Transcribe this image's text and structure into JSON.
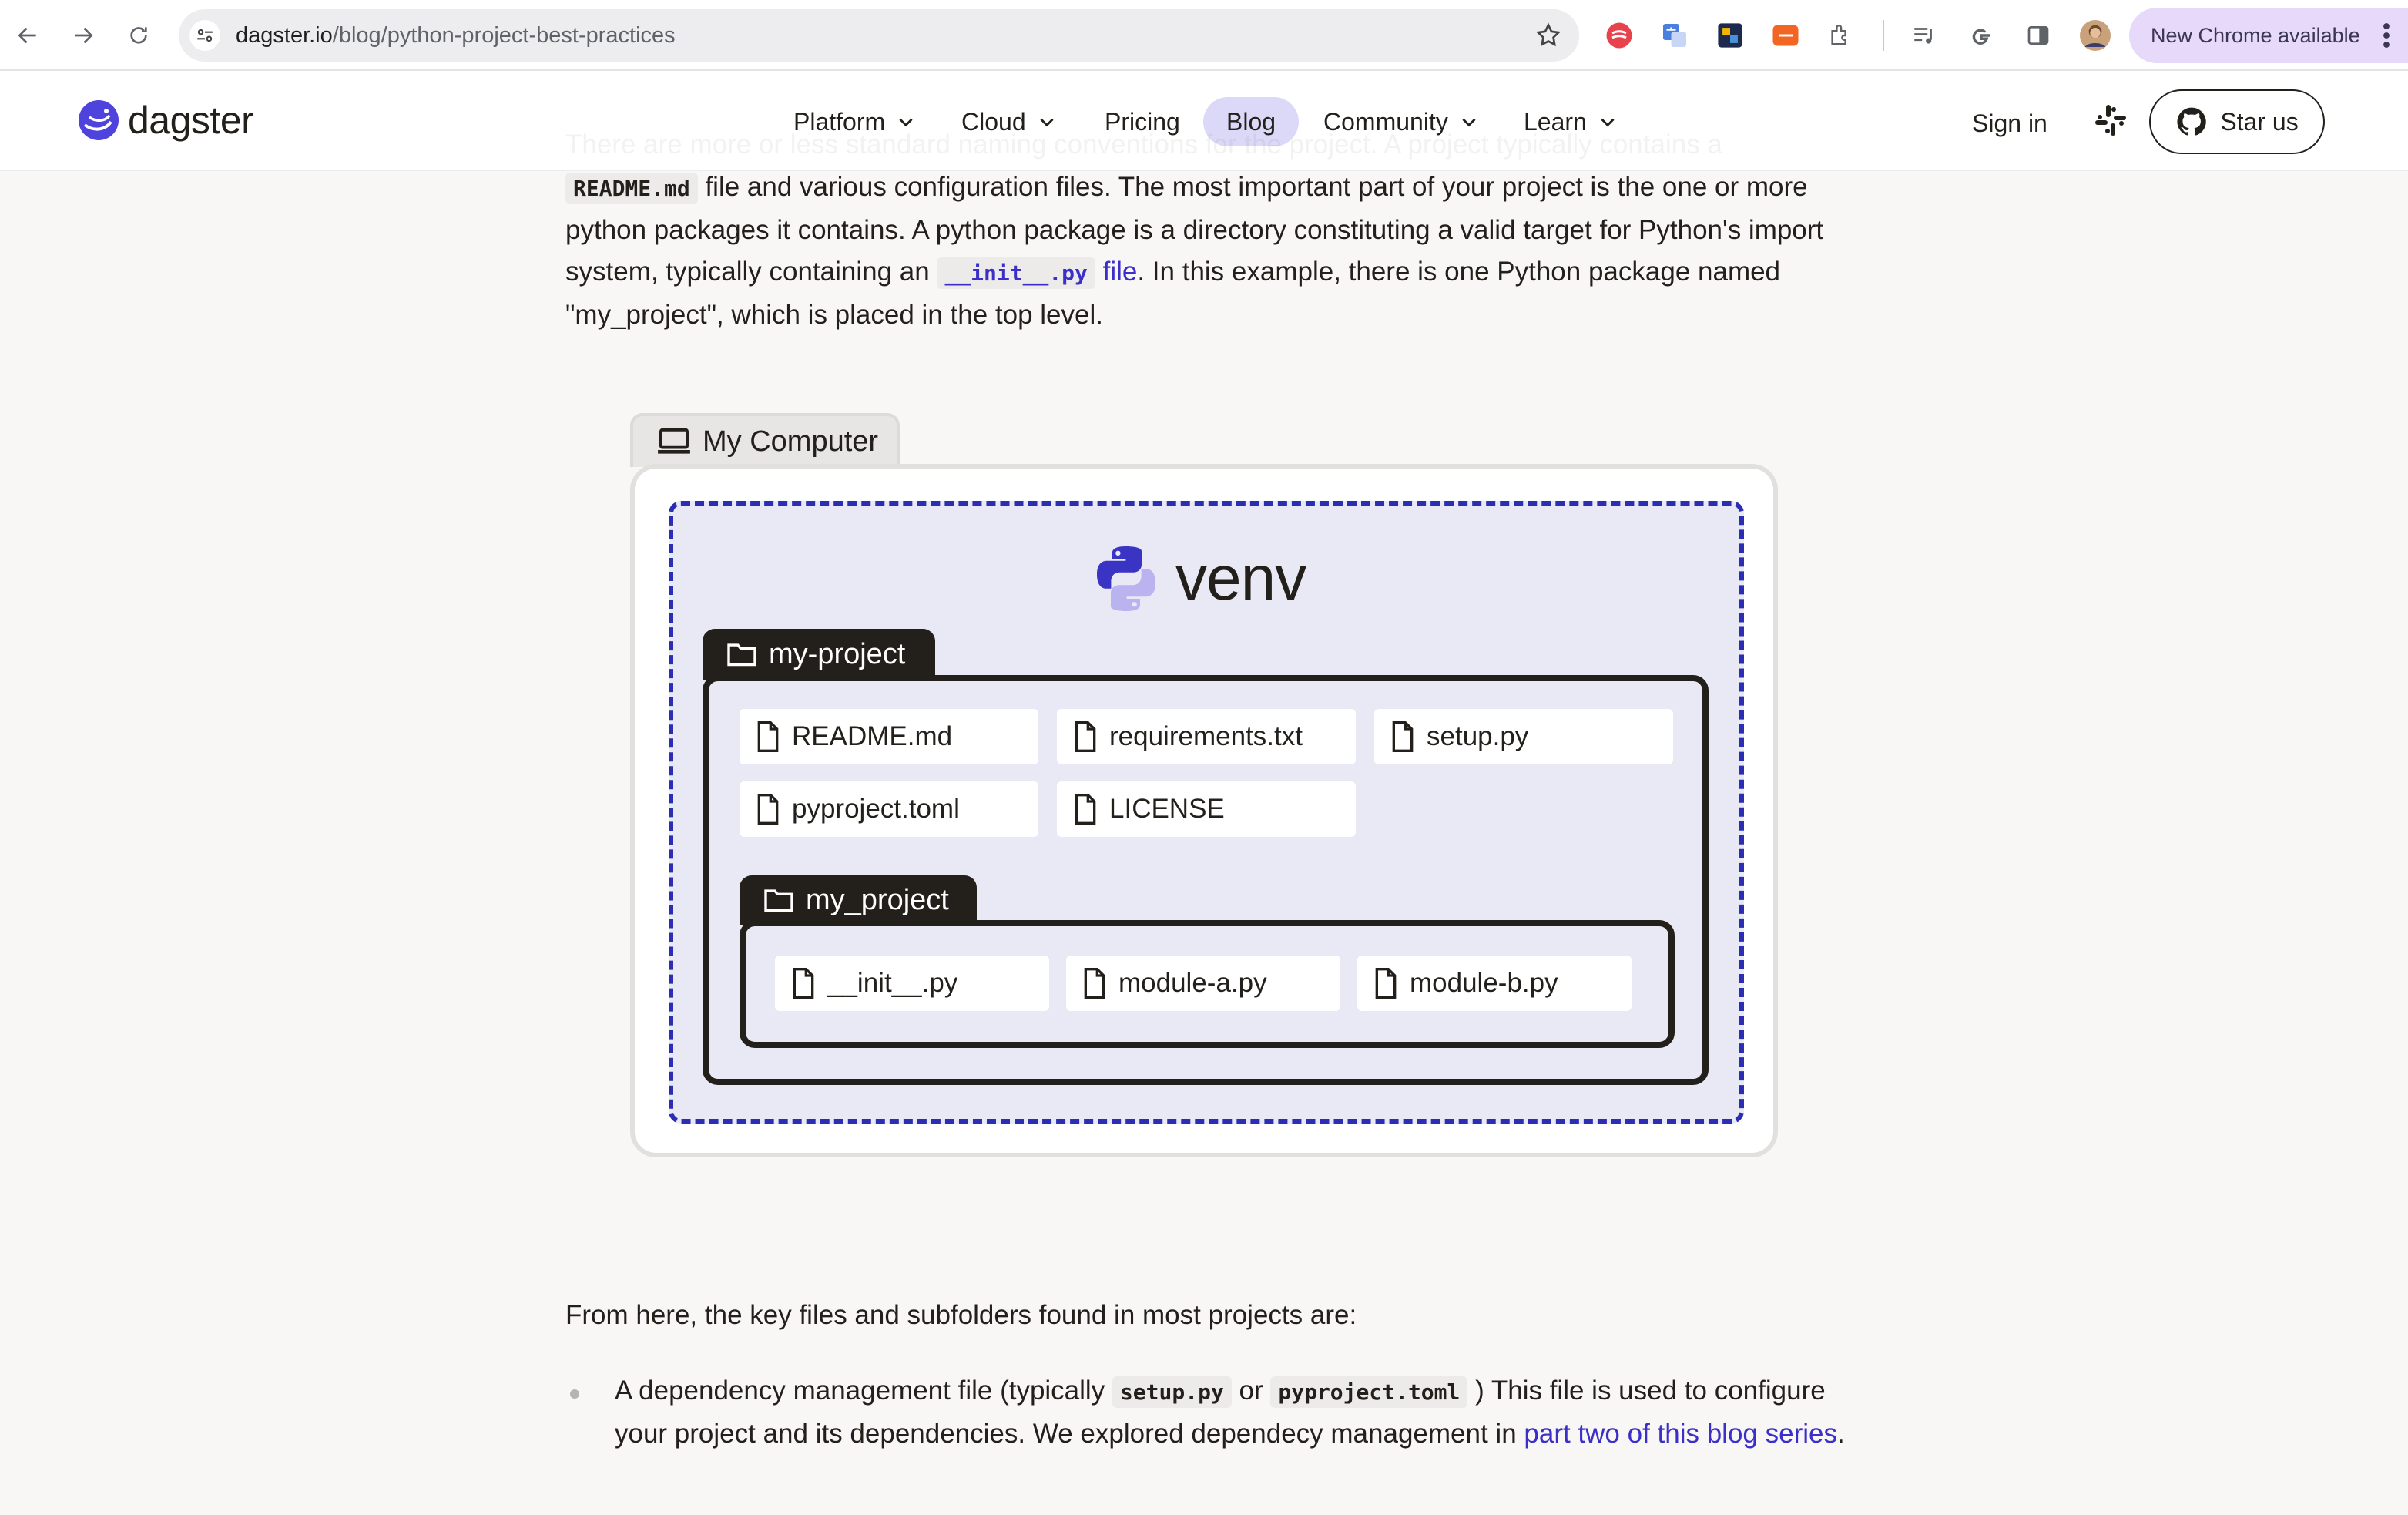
{
  "browser": {
    "url_host": "dagster.io",
    "url_path": "/blog/python-project-best-practices",
    "update_label": "New Chrome available"
  },
  "header": {
    "logo": "dagster",
    "nav": [
      {
        "label": "Platform"
      },
      {
        "label": "Cloud"
      },
      {
        "label": "Pricing"
      },
      {
        "label": "Blog"
      },
      {
        "label": "Community"
      },
      {
        "label": "Learn"
      }
    ],
    "sign_in": "Sign in",
    "star_us": "Star us"
  },
  "article": {
    "faded_line": "There are more or less standard naming conventions for the project. A project typically contains a",
    "p1": {
      "code1": "README.md",
      "t1": " file and various configuration files. The most important part of your project is the one or more python packages it contains. A python package is a directory constituting a valid target for Python's import system, typically containing an ",
      "code2": "__init__.py",
      "link": " file",
      "t2": ". In this example, there is one Python package named \"my_project\", which is placed in the top level."
    },
    "diagram": {
      "computer": "My Computer",
      "venv": "venv",
      "project_folder": "my-project",
      "project_files": [
        "README.md",
        "requirements.txt",
        "setup.py",
        "pyproject.toml",
        "LICENSE"
      ],
      "package_folder": "my_project",
      "package_files": [
        "__init__.py",
        "module-a.py",
        "module-b.py"
      ]
    },
    "p2": "From here, the key files and subfolders found in most projects are:",
    "bullet1": {
      "t1": "A dependency management file (typically ",
      "code1": "setup.py",
      "t2": " or ",
      "code2": "pyproject.toml",
      "t3": " ) This file is used to configure your project and its dependencies. We explored dependecy management in ",
      "link": "part two of this blog series",
      "t4": "."
    }
  },
  "colors": {
    "accent": "#3c2fc9",
    "venv_border": "#2b2db3",
    "venv_fill": "#e9e8f5",
    "blog_pill": "#dcd8f7",
    "update_pill": "#e6d9f9"
  }
}
